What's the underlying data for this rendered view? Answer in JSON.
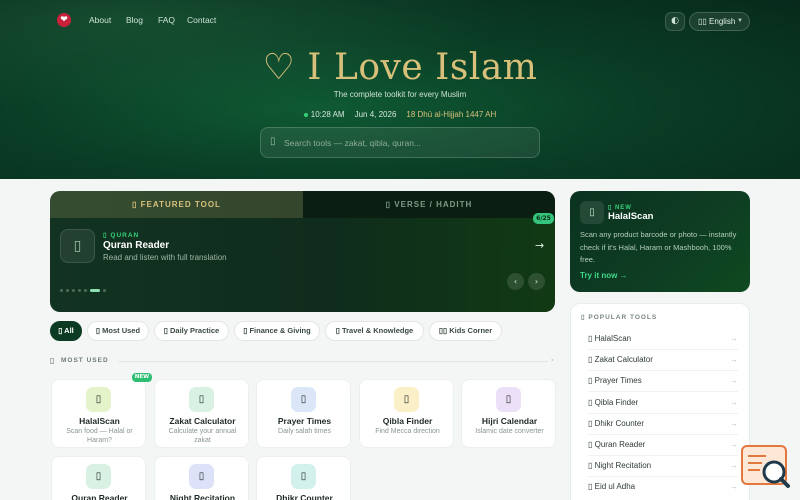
{
  "nav": {
    "logo_glyph": "❤",
    "links": [
      "About",
      "Blog",
      "FAQ",
      "Contact"
    ],
    "icon_button": "◐",
    "language": "English",
    "language_icon": "▯▯"
  },
  "hero": {
    "title": "♡ I Love Islam",
    "subtitle": "The complete toolkit for every Muslim",
    "time": "10:28 AM",
    "date": "Jun 4, 2026",
    "hijri": "18 Dhū al-Hijjah 1447 AH",
    "search_placeholder": "Search tools — zakat, qibla, quran..."
  },
  "featured": {
    "tab_featured": "▯ FEATURED TOOL",
    "tab_verse": "▯ VERSE / HADITH",
    "counter": "6/25",
    "category": "▯ QURAN",
    "title": "Quran Reader",
    "description": "Read and listen with full translation",
    "arrow": "→",
    "prev": "‹",
    "next": "›"
  },
  "halal_card": {
    "badge": "▯ NEW",
    "title": "HalalScan",
    "description": "Scan any product barcode or photo — instantly check if it's Halal, Haram or Mashbooh, 100% free.",
    "cta": "Try it now →"
  },
  "filters": [
    {
      "label": "▯ All",
      "active": true
    },
    {
      "label": "▯ Most Used",
      "active": false
    },
    {
      "label": "▯ Daily Practice",
      "active": false
    },
    {
      "label": "▯ Finance & Giving",
      "active": false
    },
    {
      "label": "▯ Travel & Knowledge",
      "active": false
    },
    {
      "label": "▯▯ Kids Corner",
      "active": false
    }
  ],
  "most_used": {
    "title": "MOST USED",
    "icon": "▯",
    "more": "›",
    "tools": [
      {
        "name": "HalalScan",
        "description": "Scan food — Halal or Haram?",
        "badge": "NEW",
        "color": "#e4f3c9"
      },
      {
        "name": "Zakat Calculator",
        "description": "Calculate your annual zakat",
        "badge": "",
        "color": "#d8f1e2"
      },
      {
        "name": "Prayer Times",
        "description": "Daily salah times",
        "badge": "",
        "color": "#dbe6f8"
      },
      {
        "name": "Qibla Finder",
        "description": "Find Mecca direction",
        "badge": "",
        "color": "#fbefc8"
      },
      {
        "name": "Hijri Calendar",
        "description": "Islamic date converter",
        "badge": "",
        "color": "#ecdff8"
      },
      {
        "name": "Quran Reader",
        "description": "",
        "badge": "",
        "color": "#d8f1e2"
      },
      {
        "name": "Night Recitation",
        "description": "",
        "badge": "",
        "color": "#dde2f8"
      },
      {
        "name": "Dhikr Counter",
        "description": "",
        "badge": "",
        "color": "#d3f1ec"
      }
    ]
  },
  "popular": {
    "title": "▯ POPULAR TOOLS",
    "items": [
      "▯ HalalScan",
      "▯ Zakat Calculator",
      "▯ Prayer Times",
      "▯ Qibla Finder",
      "▯ Dhikr Counter",
      "▯ Quran Reader",
      "▯ Night Recitation",
      "▯ Eid ul Adha"
    ],
    "arrow": "→"
  },
  "colors": {
    "brand_dark": "#0c3b24",
    "accent_gold": "#d8c07a",
    "accent_green": "#37d07a"
  }
}
